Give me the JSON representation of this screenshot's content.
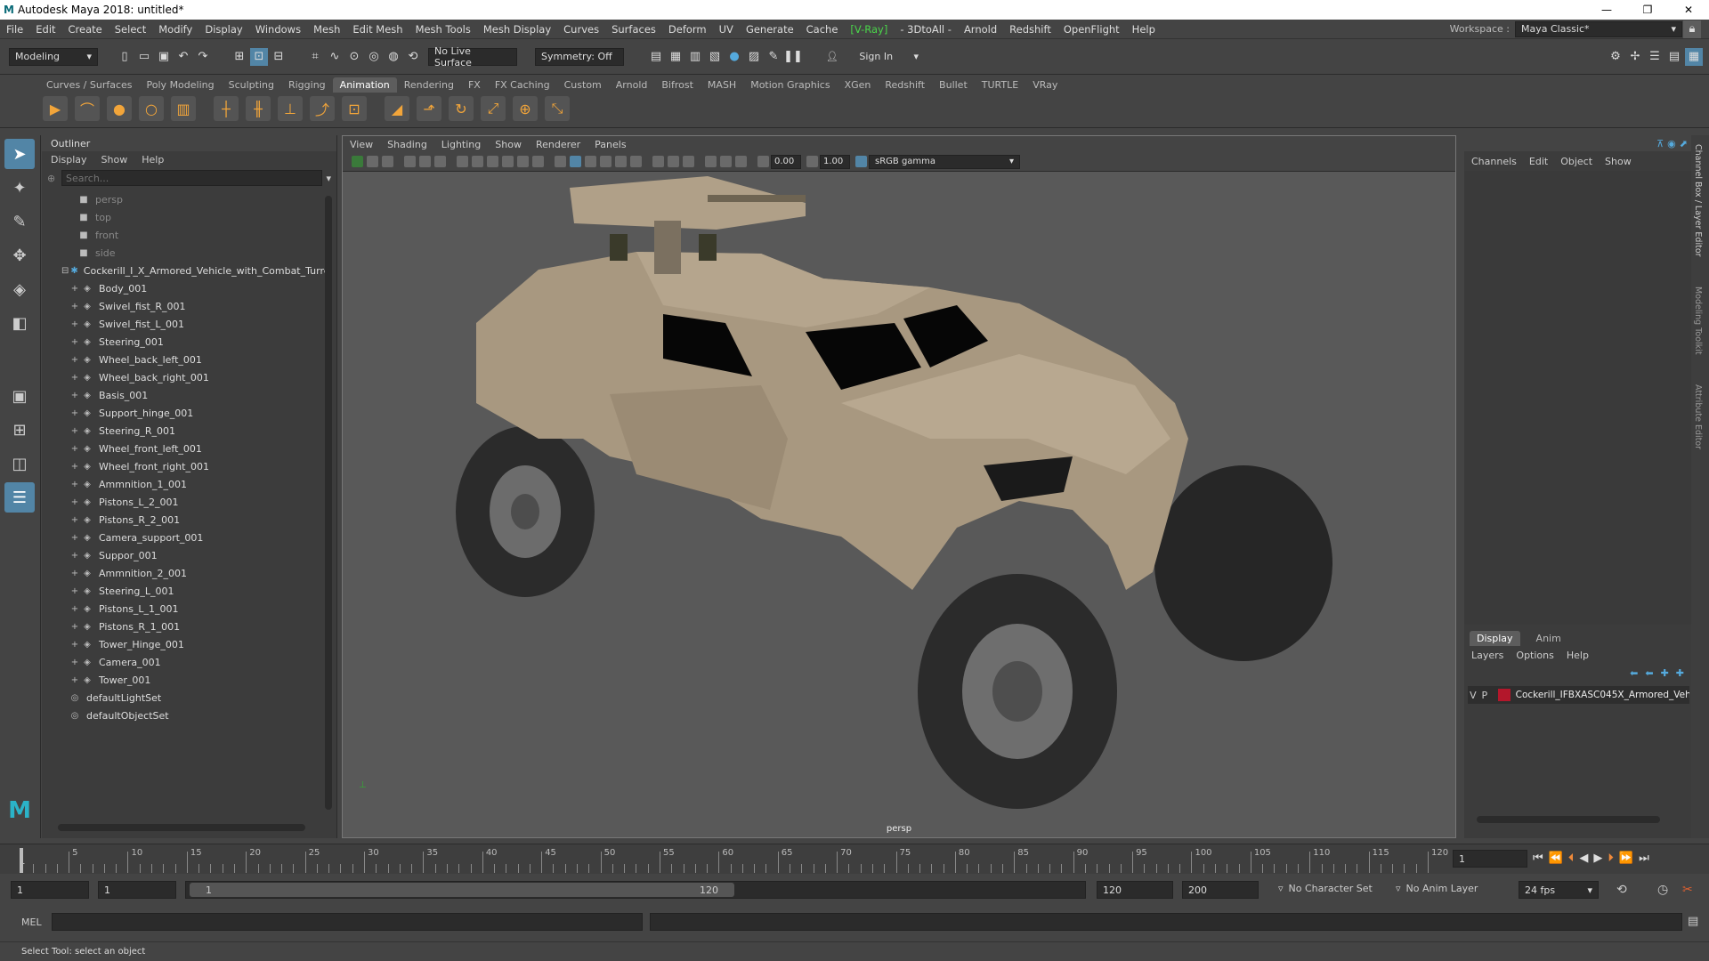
{
  "window": {
    "title": "Autodesk Maya 2018: untitled*"
  },
  "menus": [
    "File",
    "Edit",
    "Create",
    "Select",
    "Modify",
    "Display",
    "Windows",
    "Mesh",
    "Edit Mesh",
    "Mesh Tools",
    "Mesh Display",
    "Curves",
    "Surfaces",
    "Deform",
    "UV",
    "Generate",
    "Cache",
    "[V-Ray]",
    "- 3DtoAll -",
    "Arnold",
    "Redshift",
    "OpenFlight",
    "Help"
  ],
  "workspace": {
    "label": "Workspace :",
    "value": "Maya Classic*"
  },
  "status": {
    "mode": "Modeling",
    "live_surface": "No Live Surface",
    "symmetry": "Symmetry: Off",
    "sign_in": "Sign In"
  },
  "shelf_tabs": [
    "Curves / Surfaces",
    "Poly Modeling",
    "Sculpting",
    "Rigging",
    "Animation",
    "Rendering",
    "FX",
    "FX Caching",
    "Custom",
    "Arnold",
    "Bifrost",
    "MASH",
    "Motion Graphics",
    "XGen",
    "Redshift",
    "Bullet",
    "TURTLE",
    "VRay"
  ],
  "active_shelf": "Animation",
  "outliner": {
    "title": "Outliner",
    "menu": [
      "Display",
      "Show",
      "Help"
    ],
    "search_placeholder": "Search...",
    "cameras": [
      "persp",
      "top",
      "front",
      "side"
    ],
    "root": "Cockerill_I_X_Armored_Vehicle_with_Combat_Turre",
    "children": [
      "Body_001",
      "Swivel_fist_R_001",
      "Swivel_fist_L_001",
      "Steering_001",
      "Wheel_back_left_001",
      "Wheel_back_right_001",
      "Basis_001",
      "Support_hinge_001",
      "Steering_R_001",
      "Wheel_front_left_001",
      "Wheel_front_right_001",
      "Ammnition_1_001",
      "Pistons_L_2_001",
      "Pistons_R_2_001",
      "Camera_support_001",
      "Suppor_001",
      "Ammnition_2_001",
      "Steering_L_001",
      "Pistons_L_1_001",
      "Pistons_R_1_001",
      "Tower_Hinge_001",
      "Camera_001",
      "Tower_001"
    ],
    "sets": [
      "defaultLightSet",
      "defaultObjectSet"
    ]
  },
  "viewport": {
    "menu": [
      "View",
      "Shading",
      "Lighting",
      "Show",
      "Renderer",
      "Panels"
    ],
    "exposure": "0.00",
    "gamma": "1.00",
    "colorspace": "sRGB gamma",
    "camera_label": "persp"
  },
  "channel_box": {
    "menu": [
      "Channels",
      "Edit",
      "Object",
      "Show"
    ],
    "layer_tabs": [
      "Display",
      "Anim"
    ],
    "layer_menu": [
      "Layers",
      "Options",
      "Help"
    ],
    "layer": {
      "v": "V",
      "p": "P",
      "name": "Cockerill_IFBXASC045X_Armored_Veh"
    }
  },
  "side_tabs": [
    "Channel Box / Layer Editor",
    "Modeling Toolkit",
    "Attribute Editor"
  ],
  "timeline": {
    "ticks": [
      "5",
      "10",
      "15",
      "20",
      "25",
      "30",
      "35",
      "40",
      "45",
      "50",
      "55",
      "60",
      "65",
      "70",
      "75",
      "80",
      "85",
      "90",
      "95",
      "100",
      "105",
      "110",
      "115",
      "120"
    ],
    "start_tick": "1",
    "current_frame": "1"
  },
  "range": {
    "start": "1",
    "playback_start": "1",
    "slider_start": "1",
    "slider_end": "120",
    "playback_end": "120",
    "end": "200",
    "character_set": "No Character Set",
    "anim_layer": "No Anim Layer",
    "fps": "24 fps"
  },
  "mel": {
    "label": "MEL"
  },
  "help": {
    "text": "Select Tool: select an object"
  },
  "colors": {
    "accent": "#5285a6",
    "layer_red": "#b3172b",
    "vray_green": "#4ad54a",
    "vehicle": "#a89880"
  }
}
